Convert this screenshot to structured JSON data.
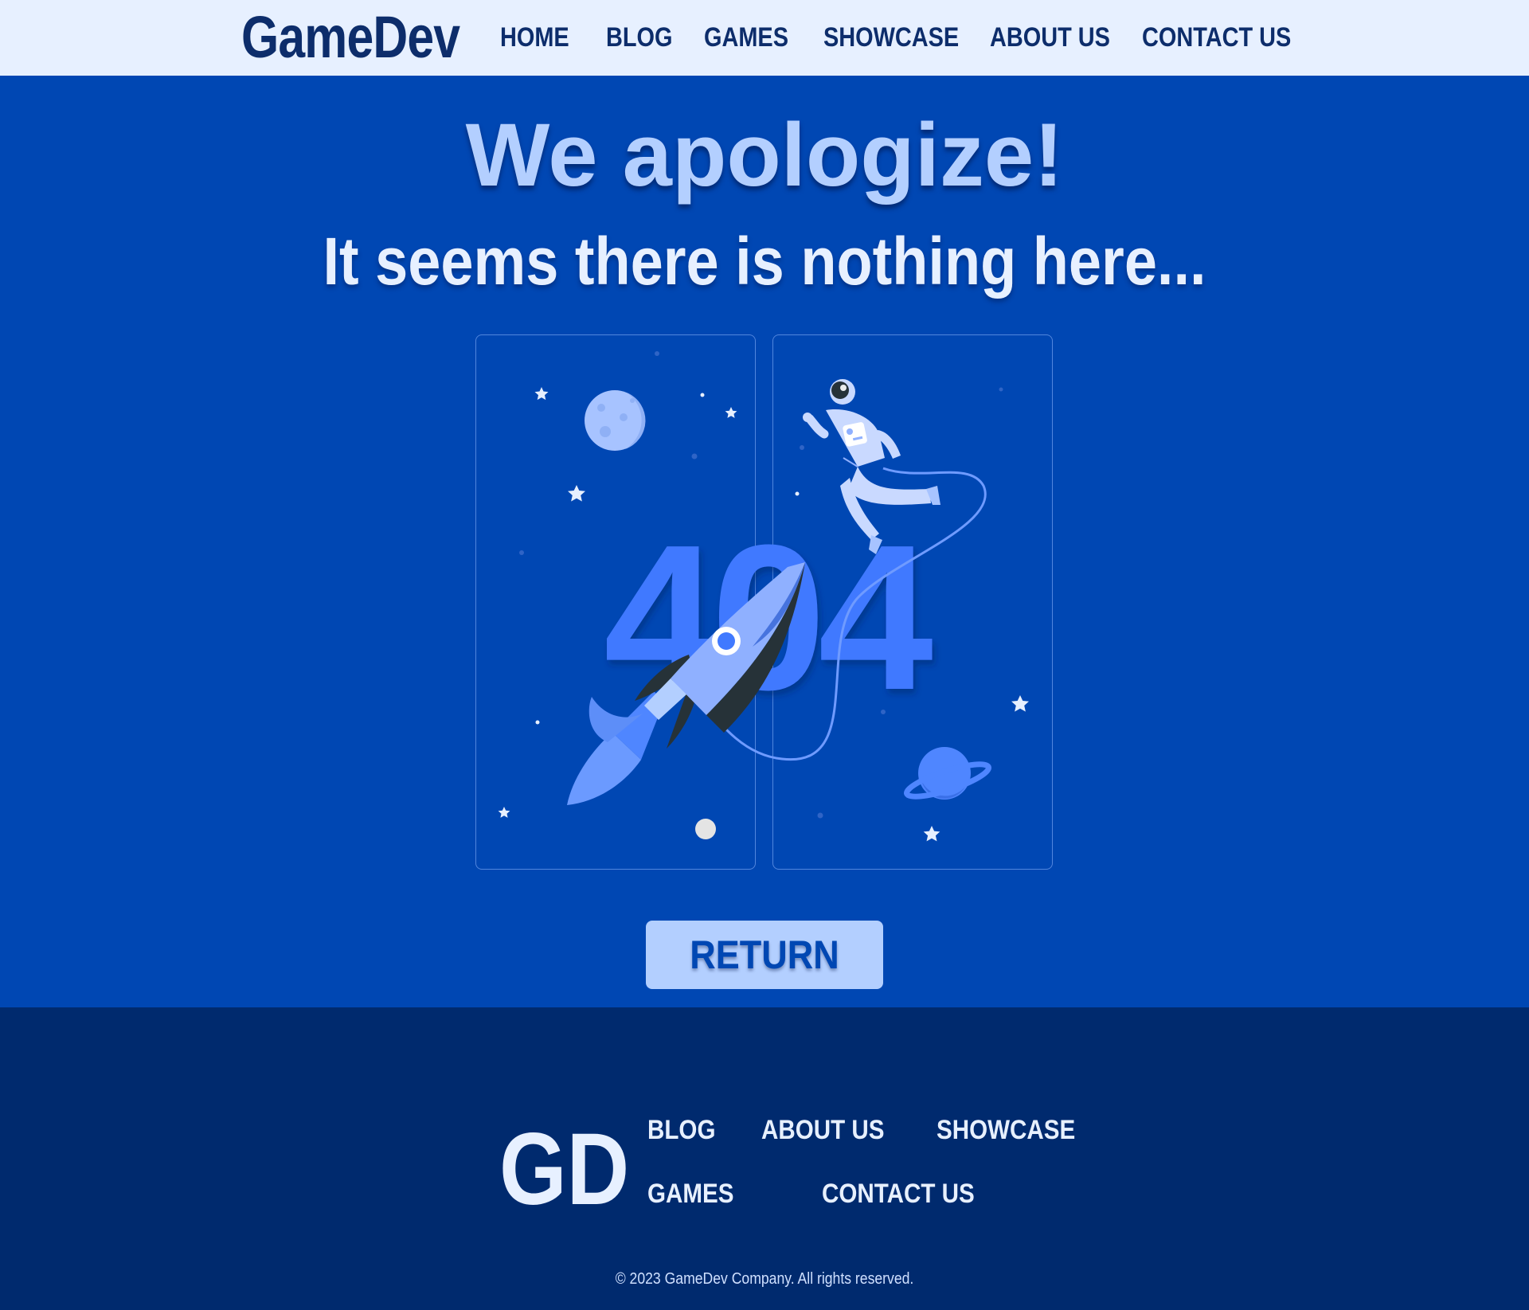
{
  "header": {
    "logo": "GameDev",
    "nav": [
      "HOME",
      "BLOG",
      "GAMES",
      "SHOWCASE",
      "ABOUT US",
      "CONTACT US"
    ]
  },
  "hero": {
    "title": "We apologize!",
    "subtitle": "It seems there is nothing here...",
    "error_code": "404",
    "return_label": "RETURN"
  },
  "footer": {
    "logo": "GD",
    "links": [
      "BLOG",
      "ABOUT US",
      "SHOWCASE",
      "GAMES",
      "CONTACT US"
    ],
    "copyright": "© 2023 GameDev Company. All rights reserved."
  },
  "colors": {
    "nav_bg": "#e7f0ff",
    "brand_dark": "#0d2d6b",
    "hero_bg": "#0047b3",
    "accent_light": "#b3cfff",
    "illustration_blue": "#4079ff",
    "footer_bg": "#002a6e"
  },
  "icons": [
    "rocket-icon",
    "astronaut-icon",
    "moon-icon",
    "planet-icon",
    "star-icon"
  ]
}
